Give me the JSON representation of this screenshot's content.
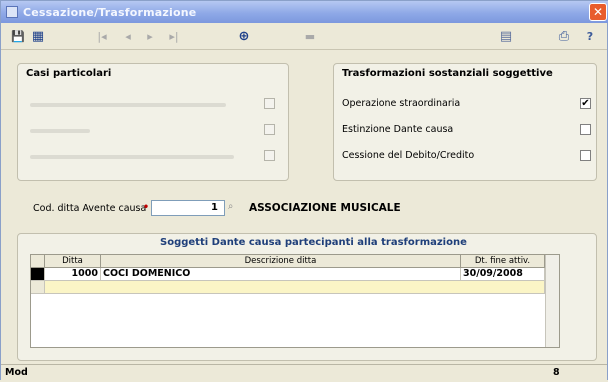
{
  "window": {
    "title": "Cessazione/Trasformazione",
    "close_label": "✕"
  },
  "toolbar": {
    "save_icon": "💾",
    "grid_icon": "▦",
    "first_icon": "|◂",
    "prev_icon": "◂",
    "next_icon": "▸",
    "last_icon": "▸|",
    "binoculars_icon": "⊕",
    "dim_icon": "▬",
    "calc_icon": "▤",
    "print_icon": "⎙",
    "help_icon": "?"
  },
  "casi": {
    "legend": "Casi particolari",
    "items": [
      {
        "checked": false
      },
      {
        "checked": false
      },
      {
        "checked": false
      }
    ]
  },
  "trasf": {
    "legend": "Trasformazioni sostanziali soggettive",
    "items": [
      {
        "label": "Operazione straordinaria",
        "checked": true,
        "mark": "✔"
      },
      {
        "label": "Estinzione Dante causa",
        "checked": false,
        "mark": ""
      },
      {
        "label": "Cessione del Debito/Credito",
        "checked": false,
        "mark": ""
      }
    ]
  },
  "avente": {
    "label": "Cod. ditta Avente causa",
    "required_mark": "•",
    "value": "1",
    "lookup_icon": "⌕",
    "company_name": "ASSOCIAZIONE MUSICALE"
  },
  "soggetti": {
    "legend": "Soggetti Dante causa partecipanti alla trasformazione",
    "columns": [
      "Ditta",
      "Descrizione ditta",
      "Dt. fine attiv."
    ],
    "rows": [
      {
        "ditta": "1000",
        "descrizione": "COCI DOMENICO",
        "data": "30/09/2008"
      }
    ]
  },
  "status": {
    "mode": "Mod",
    "right": "8"
  }
}
